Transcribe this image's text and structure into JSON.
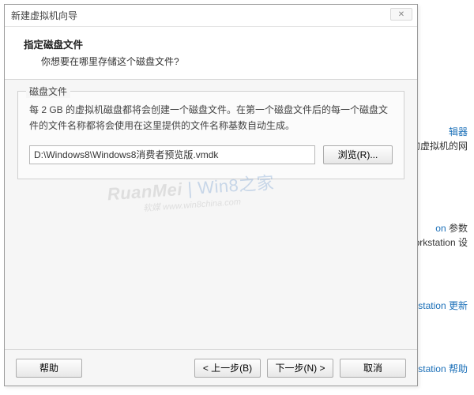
{
  "dialog": {
    "title": "新建虚拟机向导",
    "header": {
      "title": "指定磁盘文件",
      "subtitle": "你想要在哪里存储这个磁盘文件?"
    },
    "group": {
      "label": "磁盘文件",
      "description": "每 2 GB 的虚拟机磁盘都将会创建一个磁盘文件。在第一个磁盘文件后的每一个磁盘文件的文件名称都将会使用在这里提供的文件名称基数自动生成。",
      "path_value": "D:\\Windows8\\Windows8消费者预览版.vmdk",
      "browse_label": "浏览(R)..."
    },
    "footer": {
      "help": "帮助",
      "back": "< 上一步(B)",
      "next": "下一步(N) >",
      "cancel": "取消"
    },
    "close_glyph": "✕"
  },
  "watermark": {
    "main": "RuanMei",
    "side": "Win8之家",
    "sub": "软媒   www.win8china.com"
  },
  "background": {
    "l1": "辑器",
    "l2": "机上的虚拟机的网",
    "l3a": "on",
    "l3b": " 参数",
    "l4": "are Workstation 设",
    "l5": "Workstation 更新",
    "l6": "Workstation 帮助"
  }
}
